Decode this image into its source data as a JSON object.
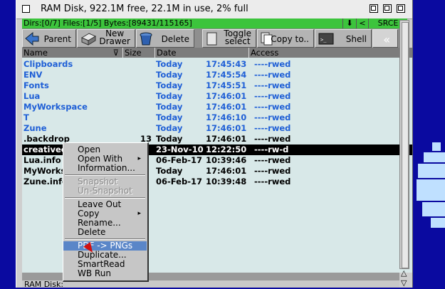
{
  "window": {
    "title": "RAM Disk,  922.1M free, 22.1M in use, 2% full"
  },
  "status": {
    "info": "Dirs:[0/7] Files:[1/5] Bytes:[89431/115165]",
    "down_glyph": "⬇",
    "back_glyph": "<",
    "srce_label": "SRCE"
  },
  "toolbar": {
    "parent": "Parent",
    "new_drawer_line1": "New",
    "new_drawer_line2": "Drawer",
    "delete": "Delete",
    "toggle_line1": "Toggle",
    "toggle_line2": "select",
    "copy_to": "Copy to..",
    "shell": "Shell",
    "more_glyph": "«"
  },
  "columns": {
    "name": "Name",
    "size": "Size",
    "date": "Date",
    "access": "Access"
  },
  "files": [
    {
      "name": "Clipboards",
      "size": "",
      "date": "Today",
      "time": "17:45:43",
      "prot": "----rwed",
      "dir": true
    },
    {
      "name": "ENV",
      "size": "",
      "date": "Today",
      "time": "17:45:54",
      "prot": "----rwed",
      "dir": true
    },
    {
      "name": "Fonts",
      "size": "",
      "date": "Today",
      "time": "17:45:51",
      "prot": "----rwed",
      "dir": true
    },
    {
      "name": "Lua",
      "size": "",
      "date": "Today",
      "time": "17:46:01",
      "prot": "----rwed",
      "dir": true
    },
    {
      "name": "MyWorkspace",
      "size": "",
      "date": "Today",
      "time": "17:46:01",
      "prot": "----rwed",
      "dir": true
    },
    {
      "name": "T",
      "size": "",
      "date": "Today",
      "time": "17:46:10",
      "prot": "----rwed",
      "dir": true
    },
    {
      "name": "Zune",
      "size": "",
      "date": "Today",
      "time": "17:46:01",
      "prot": "----rwed",
      "dir": true
    },
    {
      "name": ".backdrop",
      "size": "13",
      "date": "Today",
      "time": "17:46:01",
      "prot": "----rwed",
      "dir": false
    },
    {
      "name": "creativec",
      "size": "",
      "date": "23-Nov-10",
      "time": "12:22:50",
      "prot": "----rw-d",
      "dir": false,
      "selected": true
    },
    {
      "name": "Lua.info",
      "size": "",
      "date": "06-Feb-17",
      "time": "10:39:46",
      "prot": "----rwed",
      "dir": false
    },
    {
      "name": "MyWorks",
      "size": "",
      "date": "Today",
      "time": "17:46:01",
      "prot": "----rwed",
      "dir": false
    },
    {
      "name": "Zune.info",
      "size": "",
      "date": "06-Feb-17",
      "time": "10:39:48",
      "prot": "----rwed",
      "dir": false
    }
  ],
  "path": "RAM Disk:",
  "context_menu": {
    "open": "Open",
    "open_with": "Open With",
    "information": "Information...",
    "snapshot": "Snapshot",
    "unsnapshot": "Un-Snapshot",
    "leave_out": "Leave Out",
    "copy": "Copy",
    "rename": "Rename...",
    "delete": "Delete",
    "pdf_pngs": "PDF -> PNGs",
    "duplicate": "Duplicate...",
    "smartread": "SmartRead",
    "wb_run": "WB Run",
    "submenu_glyph": "▸"
  },
  "colors": {
    "status_green": "#3cc43c",
    "dir_blue": "#1f5fd6",
    "menu_highlight": "#5a86c8",
    "list_bg": "#d8e8e8"
  }
}
